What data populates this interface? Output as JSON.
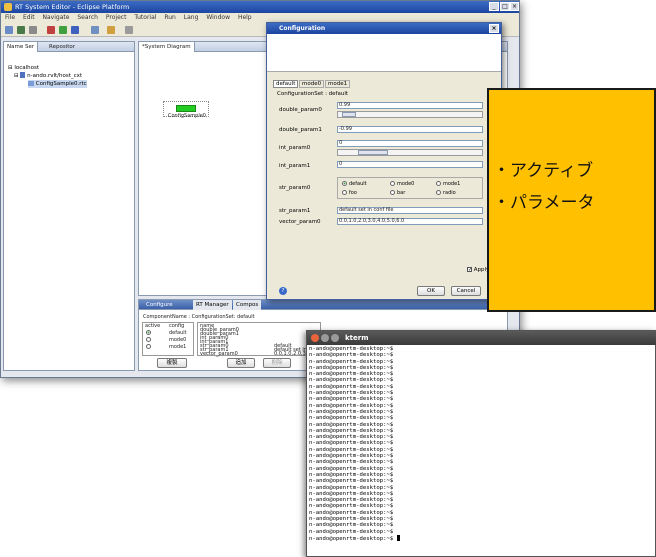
{
  "eclipse": {
    "title": "RT System Editor - Eclipse Platform",
    "menu": [
      "File",
      "Edit",
      "Navigate",
      "Search",
      "Project",
      "Tutorial",
      "Run",
      "Lang",
      "Window",
      "Help"
    ],
    "name_server_tabs": [
      "Name Ser",
      "Repositor"
    ],
    "tree": [
      "localhost",
      "n-ando.rvlt/host_cxt",
      "ConfigSample0.rtc"
    ],
    "diagram_tab": "*System Diagram",
    "component_label": "ConfigSample0",
    "bottom_tabs": [
      "Configure",
      "RT Manager",
      "Compos"
    ],
    "config_header": "ComponentName : ConfigurationSet: default",
    "config_table": {
      "headers": [
        "active",
        "config",
        "name"
      ],
      "rows": [
        {
          "active": true,
          "config": "default"
        },
        {
          "active": false,
          "config": "mode0"
        },
        {
          "active": false,
          "config": "mode1"
        }
      ],
      "names": [
        "double_param0",
        "double_param1",
        "int_param0",
        "int_param1",
        "str_param0",
        "str_param1",
        "vector_param0"
      ],
      "values": [
        "",
        "",
        "",
        "",
        "default",
        "default set in c",
        "0.0,1.0,2.0,3"
      ]
    },
    "buttons": {
      "copy": "複製",
      "add": "追加",
      "delete": "削除"
    }
  },
  "dialog": {
    "title": "Configuration",
    "set_tabs": [
      "default",
      "mode0",
      "mode1"
    ],
    "config_set_label": "ConfigurationSet : default",
    "params": [
      {
        "label": "double_param0",
        "value": "0.99"
      },
      {
        "label": "double_param1",
        "value": "-0.99"
      },
      {
        "label": "int_param0",
        "value": "0"
      },
      {
        "label": "int_param1",
        "value": "0"
      },
      {
        "label": "str_param0",
        "options": [
          "default",
          "mode0",
          "mode1",
          "foo",
          "bar",
          "radio"
        ],
        "selected": "default"
      },
      {
        "label": "str_param1",
        "value": "default set in conf file"
      },
      {
        "label": "vector_param0",
        "value": "0.0,1.0,2.0,3.0,4.0,5.0,6.0"
      }
    ],
    "apply": "Apply",
    "ok": "OK",
    "cancel": "Cancel",
    "help": "?"
  },
  "callout": {
    "lines": [
      "・アクティブ",
      "・パラメータ"
    ]
  },
  "kterm": {
    "title": "kterm",
    "prompt": "n-ando@openrtm-desktop:~$",
    "line_count": 31
  },
  "colors": {
    "callout": "#ffc000",
    "component": "#22cc22",
    "titlebar": "#1b45a0"
  }
}
